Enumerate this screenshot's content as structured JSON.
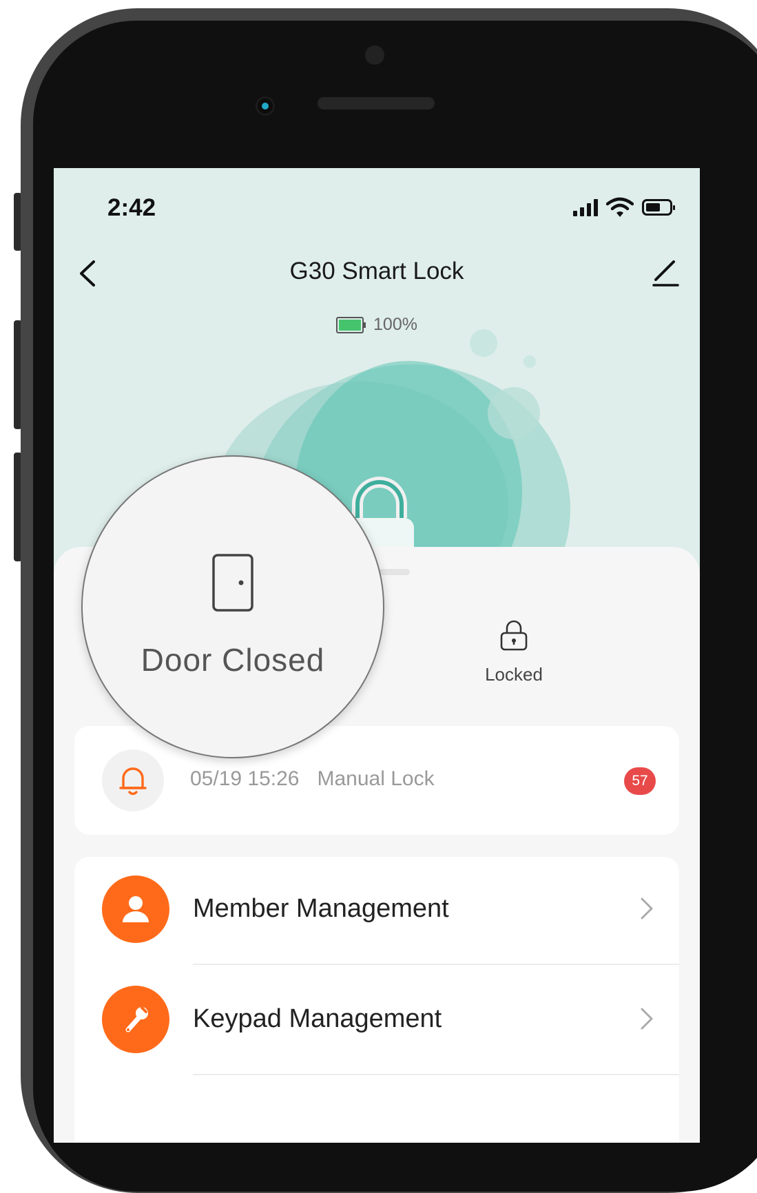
{
  "status_bar": {
    "time": "2:42"
  },
  "header": {
    "title": "G30 Smart Lock"
  },
  "battery": {
    "text": "100%",
    "level_percent": 100
  },
  "status": {
    "door": "Door Closed",
    "lock": "Locked"
  },
  "alert": {
    "datetime": "05/19 15:26",
    "event": "Manual Lock",
    "badge_count": "57"
  },
  "menu": {
    "items": [
      {
        "label": "Member Management",
        "icon": "person-icon"
      },
      {
        "label": "Keypad Management",
        "icon": "wrench-icon"
      }
    ]
  },
  "colors": {
    "accent_orange": "#ff6a1a",
    "teal": "#5cc4b4",
    "badge_red": "#e84a4a",
    "battery_green": "#45c46d"
  }
}
